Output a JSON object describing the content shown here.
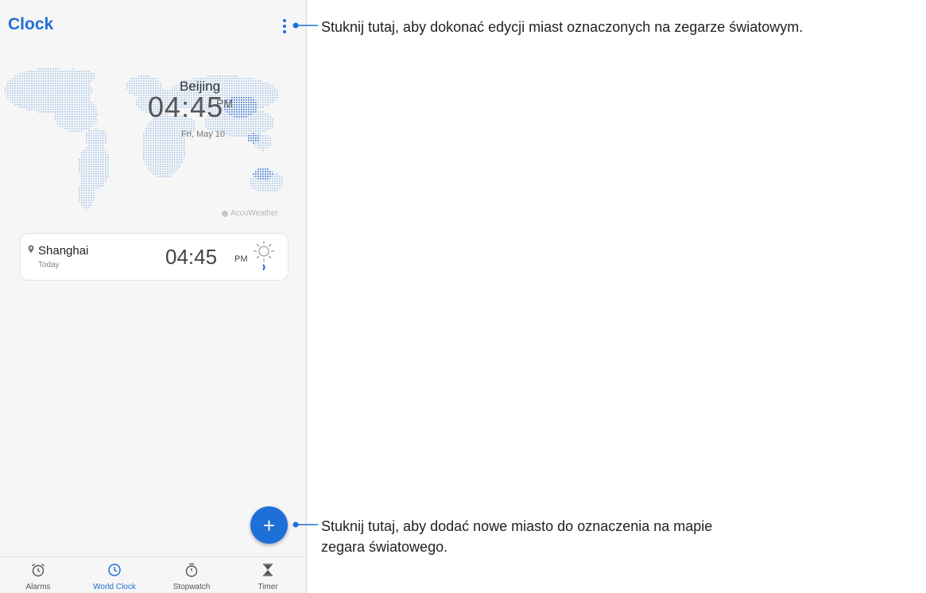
{
  "app": {
    "title": "Clock"
  },
  "map": {
    "city": "Beijing",
    "time": "04:45",
    "ampm": "PM",
    "date": "Fri, May 10",
    "attribution": "AccuWeather"
  },
  "world_clock_card": {
    "city": "Shanghai",
    "subtitle": "Today",
    "time": "04:45",
    "ampm": "PM"
  },
  "fab": {
    "label": "+"
  },
  "bottom_nav": {
    "items": [
      {
        "label": "Alarms",
        "icon": "alarm-icon"
      },
      {
        "label": "World Clock",
        "icon": "world-clock-icon",
        "active": true
      },
      {
        "label": "Stopwatch",
        "icon": "stopwatch-icon"
      },
      {
        "label": "Timer",
        "icon": "timer-icon"
      }
    ]
  },
  "callouts": {
    "menu": "Stuknij tutaj, aby dokonać edycji miast oznaczonych na zegarze światowym.",
    "add_line1": "Stuknij tutaj, aby dodać nowe miasto do oznaczenia na mapie",
    "add_line2": "zegara światowego."
  },
  "colors": {
    "accent": "#1f6fd8",
    "map_dots": "#a9c8ec",
    "map_dots_highlight": "#2d6fd0"
  }
}
